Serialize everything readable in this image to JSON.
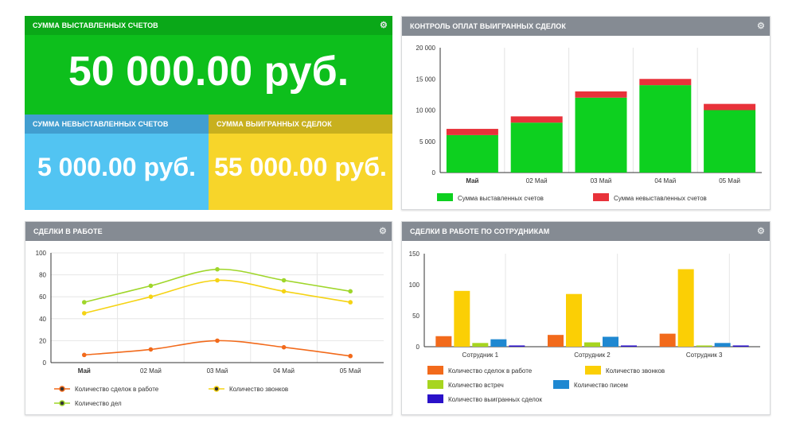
{
  "kpi": {
    "invoiced": {
      "title": "СУММА ВЫСТАВЛЕННЫХ СЧЕТОВ",
      "value": "50 000.00 руб.",
      "header_color": "#0aa818",
      "body_color": "#0dbf1c"
    },
    "not_invoiced": {
      "title": "СУММА НЕВЫСТАВЛЕННЫХ СЧЕТОВ",
      "value": "5 000.00 руб.",
      "header_color": "#419ed0",
      "body_color": "#52c4f2"
    },
    "won": {
      "title": "СУММА ВЫИГРАННЫХ СДЕЛОК",
      "value": "55 000.00 руб.",
      "header_color": "#c8b01e",
      "body_color": "#f7d52a"
    }
  },
  "panels": {
    "payments": {
      "title": "КОНТРОЛЬ ОПЛАТ ВЫИГРАННЫХ СДЕЛОК"
    },
    "deals": {
      "title": "СДЕЛКИ В РАБОТЕ"
    },
    "employees": {
      "title": "СДЕЛКИ В РАБОТЕ ПО СОТРУДНИКАМ"
    }
  },
  "chart_data": [
    {
      "id": "payments",
      "type": "bar",
      "stacked": true,
      "categories": [
        "Май",
        "02 Май",
        "03 Май",
        "04 Май",
        "05 Май"
      ],
      "series": [
        {
          "name": "Сумма выставленных счетов",
          "color": "#0dd01f",
          "values": [
            6000,
            8000,
            12000,
            14000,
            10000
          ]
        },
        {
          "name": "Сумма невыставленных счетов",
          "color": "#e8323a",
          "values": [
            1000,
            1000,
            1000,
            1000,
            1000
          ]
        }
      ],
      "ylim": [
        0,
        20000
      ],
      "yticks": [
        "0",
        "5 000",
        "10 000",
        "15 000",
        "20 000"
      ],
      "grid": "vertical",
      "legend": "bottom"
    },
    {
      "id": "deals",
      "type": "line",
      "categories": [
        "Май",
        "02 Май",
        "03 Май",
        "04 Май",
        "05 Май"
      ],
      "series": [
        {
          "name": "Количество сделок в работе",
          "color": "#f26a1b",
          "values": [
            7,
            12,
            20,
            14,
            6
          ]
        },
        {
          "name": "Количество звонков",
          "color": "#f5d313",
          "values": [
            45,
            60,
            75,
            65,
            55
          ]
        },
        {
          "name": "Количество дел",
          "color": "#9fd62a",
          "values": [
            55,
            70,
            85,
            75,
            65
          ]
        }
      ],
      "ylim": [
        0,
        100
      ],
      "yticks": [
        "0",
        "20",
        "40",
        "60",
        "80",
        "100"
      ],
      "grid": "both",
      "legend": "bottom"
    },
    {
      "id": "employees",
      "type": "bar",
      "categories": [
        "Сотрудник 1",
        "Сотрудник 2",
        "Сотрудник 3"
      ],
      "series": [
        {
          "name": "Количество сделок в работе",
          "color": "#f26a1b",
          "values": [
            17,
            19,
            21
          ]
        },
        {
          "name": "Количество звонков",
          "color": "#fbcf05",
          "values": [
            90,
            85,
            125
          ]
        },
        {
          "name": "Количество встреч",
          "color": "#a7d51f",
          "values": [
            6,
            7,
            2
          ]
        },
        {
          "name": "Количество писем",
          "color": "#1f88d1",
          "values": [
            12,
            16,
            6
          ]
        },
        {
          "name": "Количество выигранных сделок",
          "color": "#2a11c9",
          "values": [
            2,
            2,
            2
          ]
        }
      ],
      "ylim": [
        0,
        150
      ],
      "yticks": [
        "0",
        "50",
        "100",
        "150"
      ],
      "grid": "vertical",
      "legend": "bottom"
    }
  ]
}
